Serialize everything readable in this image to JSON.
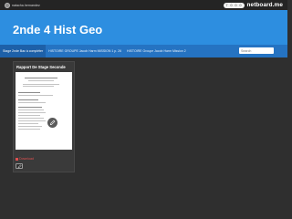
{
  "topbar": {
    "username": "natacha.hernandez",
    "pill_items": [
      "7",
      "0",
      "0",
      "0"
    ],
    "brand": "netboard.me"
  },
  "header": {
    "title": "2nde 4 Hist Geo"
  },
  "tabs": [
    {
      "label": "Stage 2nde Bac à compléter"
    },
    {
      "label": "HISTOIRE GROUPE Jacob Harm MISSION 1 p. 26"
    },
    {
      "label": "HISTOIRE Groupe Jacob Harm Mission 2"
    }
  ],
  "search": {
    "placeholder": "Search"
  },
  "card": {
    "title": "Rapport De Stage Seconde",
    "download_label": "Download"
  },
  "colors": {
    "header": "#2d8ee0",
    "tabbar": "#2573c2",
    "background": "#2f2f2f",
    "download": "#e05050"
  }
}
